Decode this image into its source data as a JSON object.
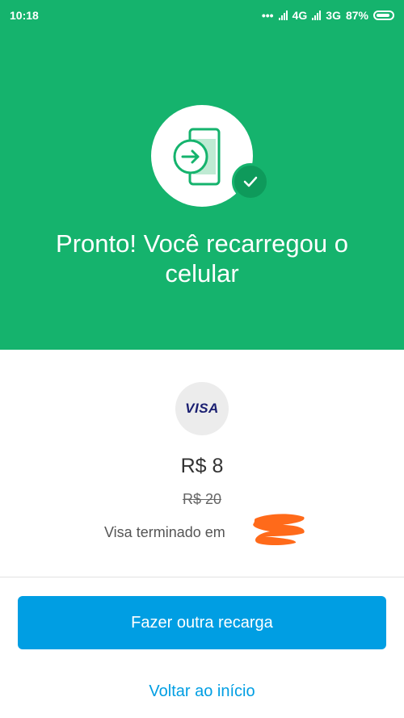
{
  "status_bar": {
    "time": "10:18",
    "dots": "•••",
    "network_1": "4G",
    "network_2": "3G",
    "battery": "87%"
  },
  "hero": {
    "title": "Pronto! Você recarregou o celular",
    "icon": "phone-recharge-icon",
    "badge_icon": "check-icon",
    "background_color": "#15b36d"
  },
  "payment": {
    "card_brand": "VISA",
    "amount": "R$ 8",
    "original_amount": "R$ 20",
    "card_text": "Visa terminado em"
  },
  "actions": {
    "primary_label": "Fazer outra recarga",
    "secondary_label": "Voltar ao início",
    "accent_color": "#009ee3"
  }
}
